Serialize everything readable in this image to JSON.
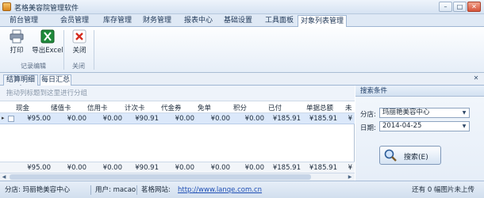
{
  "window": {
    "title": "茗格美容院管理软件",
    "buttons": {
      "minimize": "–",
      "maximize": "□",
      "close": "✕"
    }
  },
  "ribbon": {
    "tabs": [
      "前台管理",
      "会员管理",
      "库存管理",
      "财务管理",
      "报表中心",
      "基础设置",
      "工具面板",
      "对象列表管理"
    ],
    "active_tab": "对象列表管理",
    "groups": [
      {
        "label": "记录编辑",
        "buttons": [
          {
            "label": "打印",
            "icon": "printer-icon"
          },
          {
            "label": "导出Excel",
            "icon": "excel-icon"
          }
        ]
      },
      {
        "label": "关闭",
        "buttons": [
          {
            "label": "关闭",
            "icon": "close-red-icon"
          }
        ]
      }
    ]
  },
  "doc_tabs": {
    "items": [
      "结算明细表",
      "每日汇总"
    ],
    "active": "每日汇总",
    "close_glyph": "✕"
  },
  "grid": {
    "group_hint": "拖动列标题到这里进行分组",
    "columns": [
      "现金",
      "储值卡",
      "信用卡",
      "计次卡",
      "代金券",
      "免单",
      "积分",
      "已付",
      "单据总额",
      "未"
    ],
    "rows": [
      [
        "¥95.00",
        "¥0.00",
        "¥0.00",
        "¥90.91",
        "¥0.00",
        "¥0.00",
        "¥0.00",
        "¥185.91",
        "¥185.91",
        "¥"
      ]
    ],
    "footer": [
      "¥95.00",
      "¥0.00",
      "¥0.00",
      "¥90.91",
      "¥0.00",
      "¥0.00",
      "¥0.00",
      "¥185.91",
      "¥185.91",
      "¥"
    ],
    "row_indicator": "▸"
  },
  "search_panel": {
    "title": "搜索条件",
    "store_label": "分店:",
    "store_value": "玛丽艳美容中心",
    "date_label": "日期:",
    "date_value": "2014-04-25",
    "search_button": "搜索(E)"
  },
  "status_bar": {
    "store": "分店: 玛丽艳美容中心",
    "user": "用户: macao",
    "site_label": "茗格网站:",
    "site_url": "http://www.lanqe.com.cn",
    "right_text": "还有 0 幅图片未上传"
  },
  "colors": {
    "accent": "#1f4fb5",
    "row_selected": "#dbe8fa",
    "ribbon_bg": "#e6eef8"
  }
}
